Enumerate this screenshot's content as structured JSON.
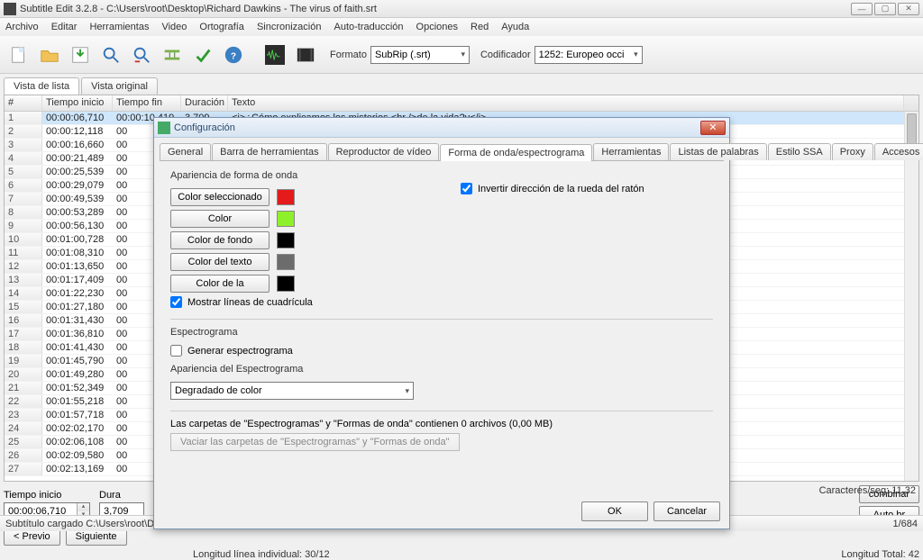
{
  "window": {
    "title": "Subtitle Edit 3.2.8 - C:\\Users\\root\\Desktop\\Richard Dawkins - The virus of faith.srt"
  },
  "menu": [
    "Archivo",
    "Editar",
    "Herramientas",
    "Video",
    "Ortografía",
    "Sincronización",
    "Auto-traducción",
    "Opciones",
    "Red",
    "Ayuda"
  ],
  "toolbar_icons": [
    "new",
    "open",
    "save",
    "find",
    "replace",
    "visual-sync",
    "spellcheck",
    "settings",
    "help",
    "waveform",
    "video"
  ],
  "format_label": "Formato",
  "format_value": "SubRip (.srt)",
  "encoding_label": "Codificador",
  "encoding_value": "1252: Europeo occi",
  "view_tabs": [
    "Vista de lista",
    "Vista original"
  ],
  "columns": {
    "num": "#",
    "start": "Tiempo inicio",
    "end": "Tiempo fin",
    "dur": "Duración",
    "text": "Texto"
  },
  "rows": [
    {
      "n": "1",
      "s": "00:00:06,710",
      "e": "00:00:10,419",
      "d": "3,709",
      "t": "<i>¿Cómo explicamos los misterios <br />de la vida?y</i>"
    },
    {
      "n": "2",
      "s": "00:00:12,118",
      "e": "00",
      "d": "",
      "t": ""
    },
    {
      "n": "3",
      "s": "00:00:16,660",
      "e": "00",
      "d": "",
      "t": ""
    },
    {
      "n": "4",
      "s": "00:00:21,489",
      "e": "00",
      "d": "",
      "t": ""
    },
    {
      "n": "5",
      "s": "00:00:25,539",
      "e": "00",
      "d": "",
      "t": ""
    },
    {
      "n": "6",
      "s": "00:00:29,079",
      "e": "00",
      "d": "",
      "t": ""
    },
    {
      "n": "7",
      "s": "00:00:49,539",
      "e": "00",
      "d": "",
      "t": ""
    },
    {
      "n": "8",
      "s": "00:00:53,289",
      "e": "00",
      "d": "",
      "t": ""
    },
    {
      "n": "9",
      "s": "00:00:56,130",
      "e": "00",
      "d": "",
      "t": ""
    },
    {
      "n": "10",
      "s": "00:01:00,728",
      "e": "00",
      "d": "",
      "t": ""
    },
    {
      "n": "11",
      "s": "00:01:08,310",
      "e": "00",
      "d": "",
      "t": ""
    },
    {
      "n": "12",
      "s": "00:01:13,650",
      "e": "00",
      "d": "",
      "t": ""
    },
    {
      "n": "13",
      "s": "00:01:17,409",
      "e": "00",
      "d": "",
      "t": ""
    },
    {
      "n": "14",
      "s": "00:01:22,230",
      "e": "00",
      "d": "",
      "t": ""
    },
    {
      "n": "15",
      "s": "00:01:27,180",
      "e": "00",
      "d": "",
      "t": ""
    },
    {
      "n": "16",
      "s": "00:01:31,430",
      "e": "00",
      "d": "",
      "t": ""
    },
    {
      "n": "17",
      "s": "00:01:36,810",
      "e": "00",
      "d": "",
      "t": ""
    },
    {
      "n": "18",
      "s": "00:01:41,430",
      "e": "00",
      "d": "",
      "t": ""
    },
    {
      "n": "19",
      "s": "00:01:45,790",
      "e": "00",
      "d": "",
      "t": ""
    },
    {
      "n": "20",
      "s": "00:01:49,280",
      "e": "00",
      "d": "",
      "t": ""
    },
    {
      "n": "21",
      "s": "00:01:52,349",
      "e": "00",
      "d": "",
      "t": ""
    },
    {
      "n": "22",
      "s": "00:01:55,218",
      "e": "00",
      "d": "",
      "t": ""
    },
    {
      "n": "23",
      "s": "00:01:57,718",
      "e": "00",
      "d": "",
      "t": ""
    },
    {
      "n": "24",
      "s": "00:02:02,170",
      "e": "00",
      "d": "",
      "t": ""
    },
    {
      "n": "25",
      "s": "00:02:06,108",
      "e": "00",
      "d": "",
      "t": ""
    },
    {
      "n": "26",
      "s": "00:02:09,580",
      "e": "00",
      "d": "",
      "t": ""
    },
    {
      "n": "27",
      "s": "00:02:13,169",
      "e": "00",
      "d": "",
      "t": ""
    }
  ],
  "edit": {
    "start_label": "Tiempo inicio",
    "start_value": "00:00:06,710",
    "dur_label": "Dura",
    "dur_value": "3,709",
    "prev": "< Previo",
    "next": "Siguiente",
    "chars_sec": "Caracteres/seg: 11,32",
    "combine": "combinar",
    "autobr": "Auto br",
    "line_len": "Longitud línea individual: 30/12",
    "total_len": "Longitud Total: 42"
  },
  "status": {
    "msg": "Subtítulo cargado C:\\Users\\root\\Desktop\\Richard Dawkins - The virus of faith.srt",
    "page": "1/684"
  },
  "dialog": {
    "title": "Configuración",
    "tabs": [
      "General",
      "Barra de herramientas",
      "Reproductor de vídeo",
      "Forma de onda/espectrograma",
      "Herramientas",
      "Listas de palabras",
      "Estilo SSA",
      "Proxy",
      "Accesos d"
    ],
    "active_tab": 3,
    "section1": "Apariencia de forma de onda",
    "colors": [
      {
        "label": "Color seleccionado",
        "hex": "#e51b1b"
      },
      {
        "label": "Color",
        "hex": "#8ef02a"
      },
      {
        "label": "Color de fondo",
        "hex": "#000000"
      },
      {
        "label": "Color del texto",
        "hex": "#6c6c6c"
      },
      {
        "label": "Color de la",
        "hex": "#000000"
      }
    ],
    "grid_chk": "Mostrar líneas de cuadrícula",
    "invert_chk": "Invertir dirección de la rueda del ratón",
    "section2": "Espectrograma",
    "gen_chk": "Generar espectrograma",
    "section3": "Apariencia del Espectrograma",
    "combo_val": "Degradado de color",
    "folders_info": "Las carpetas de \"Espectrogramas\" y \"Formas de onda\" contienen 0 archivos (0,00 MB)",
    "empty_btn": "Vaciar las carpetas de \"Espectrogramas\" y \"Formas de onda\"",
    "ok": "OK",
    "cancel": "Cancelar"
  }
}
